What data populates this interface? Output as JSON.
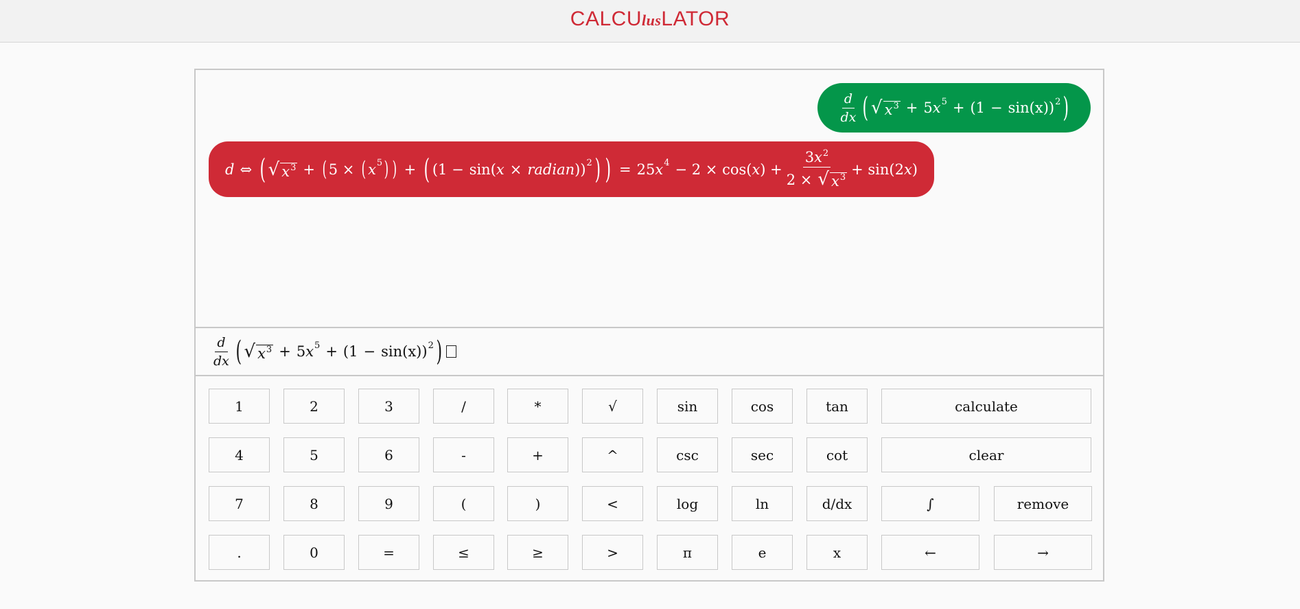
{
  "header": {
    "brand_left": "CALCU",
    "brand_mid": "lus",
    "brand_right": "LATOR",
    "brand_color": "#cf2a36"
  },
  "history": {
    "question_color": "#04964a",
    "answer_color": "#cf2a36",
    "question": {
      "deriv_num": "d",
      "deriv_den": "dx",
      "x3_base": "x",
      "x3_exp": "3",
      "plus1": "+",
      "coef5": "5",
      "x5_base": "x",
      "x5_exp": "5",
      "plus2": "+",
      "paren_open": "(",
      "one": "1",
      "minus": "−",
      "sin": "sin",
      "arg": "(x)",
      "paren_close": ")",
      "sq_exp": "2"
    },
    "answer": {
      "d": "d",
      "iff": "⇔",
      "x3_base": "x",
      "x3_exp": "3",
      "plus1": "+",
      "five_times": "5 ×",
      "x5_base": "x",
      "x5_exp": "5",
      "plus2": "+",
      "one_minus": "1 −",
      "sin": "sin",
      "arg_open": "(",
      "arg_x": "x",
      "times": "×",
      "radian": "radian",
      "arg_close": "))",
      "sq_exp": "2",
      "equals": "=",
      "term1": "25",
      "term1_var": "x",
      "term1_exp": "4",
      "term2": "− 2 × cos(",
      "term2_var": "x",
      "term2_close": ") +",
      "frac_num_coef": "3",
      "frac_num_var": "x",
      "frac_num_exp": "2",
      "frac_den_coef": "2 ×",
      "frac_den_var": "x",
      "frac_den_exp": "3",
      "tail": "+ sin(2",
      "tail_var": "x",
      "tail_close": ")"
    }
  },
  "input": {
    "deriv_num": "d",
    "deriv_den": "dx",
    "x3_base": "x",
    "x3_exp": "3",
    "plus1": "+",
    "coef5": "5",
    "x5_base": "x",
    "x5_exp": "5",
    "plus2": "+",
    "paren_open": "(",
    "one": "1",
    "minus": "−",
    "sin": "sin",
    "arg": "(x)",
    "paren_close": ")",
    "sq_exp": "2"
  },
  "keypad": {
    "keys": [
      {
        "label": "1",
        "name": "key-1"
      },
      {
        "label": "2",
        "name": "key-2"
      },
      {
        "label": "3",
        "name": "key-3"
      },
      {
        "label": "/",
        "name": "key-divide"
      },
      {
        "label": "*",
        "name": "key-multiply"
      },
      {
        "label": "√",
        "name": "key-sqrt"
      },
      {
        "label": "sin",
        "name": "key-sin"
      },
      {
        "label": "cos",
        "name": "key-cos"
      },
      {
        "label": "tan",
        "name": "key-tan"
      },
      {
        "label": "calculate",
        "name": "calculate-button"
      },
      {
        "label": "4",
        "name": "key-4"
      },
      {
        "label": "5",
        "name": "key-5"
      },
      {
        "label": "6",
        "name": "key-6"
      },
      {
        "label": "-",
        "name": "key-minus"
      },
      {
        "label": "+",
        "name": "key-plus"
      },
      {
        "label": "^",
        "name": "key-power"
      },
      {
        "label": "csc",
        "name": "key-csc"
      },
      {
        "label": "sec",
        "name": "key-sec"
      },
      {
        "label": "cot",
        "name": "key-cot"
      },
      {
        "label": "clear",
        "name": "clear-button"
      },
      {
        "label": "7",
        "name": "key-7"
      },
      {
        "label": "8",
        "name": "key-8"
      },
      {
        "label": "9",
        "name": "key-9"
      },
      {
        "label": "(",
        "name": "key-open-paren"
      },
      {
        "label": ")",
        "name": "key-close-paren"
      },
      {
        "label": "<",
        "name": "key-less-than"
      },
      {
        "label": "log",
        "name": "key-log"
      },
      {
        "label": "ln",
        "name": "key-ln"
      },
      {
        "label": "d/dx",
        "name": "key-derivative"
      },
      {
        "label": "∫",
        "name": "key-integral"
      },
      {
        "label": "remove",
        "name": "remove-button"
      },
      {
        "label": ".",
        "name": "key-decimal"
      },
      {
        "label": "0",
        "name": "key-0"
      },
      {
        "label": "=",
        "name": "key-equals"
      },
      {
        "label": "≤",
        "name": "key-less-equal"
      },
      {
        "label": "≥",
        "name": "key-greater-equal"
      },
      {
        "label": ">",
        "name": "key-greater-than"
      },
      {
        "label": "π",
        "name": "key-pi"
      },
      {
        "label": "e",
        "name": "key-e"
      },
      {
        "label": "x",
        "name": "key-x"
      },
      {
        "label": "←",
        "name": "cursor-left-button"
      },
      {
        "label": "→",
        "name": "cursor-right-button"
      }
    ]
  }
}
